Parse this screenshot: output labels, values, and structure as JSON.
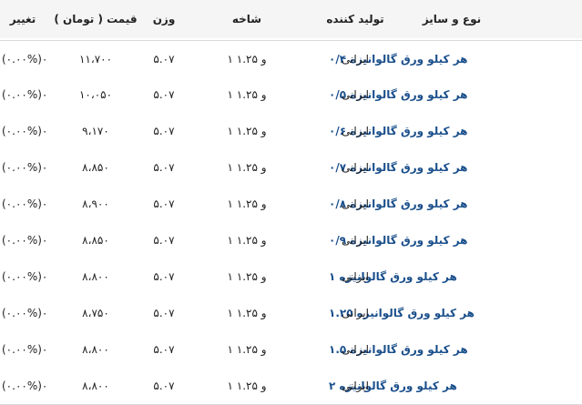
{
  "columns": {
    "name": "نوع و سایز",
    "producer": "تولید کننده",
    "branch": "شاخه",
    "weight": "وزن",
    "price": "قیمت ( تومان )",
    "change": "تغییر"
  },
  "rows": [
    {
      "name": "هر کیلو ورق گالوانیزه ۰/۴",
      "producer": "ایرانی",
      "branch": "۱ و ۱.۲۵",
      "weight": "۵.۰۷",
      "price": "۱۱،۷۰۰",
      "change": "(۰.۰۰%)۰"
    },
    {
      "name": "هر کیلو ورق گالوانیزه ۰/۵",
      "producer": "ایرانی",
      "branch": "۱ و ۱.۲۵",
      "weight": "۵.۰۷",
      "price": "۱۰،۰۵۰",
      "change": "(۰.۰۰%)۰"
    },
    {
      "name": "هر کیلو ورق گالوانیزه ۰/۶",
      "producer": "ایرانی",
      "branch": "۱ و ۱.۲۵",
      "weight": "۵.۰۷",
      "price": "۹،۱۷۰",
      "change": "(۰.۰۰%)۰"
    },
    {
      "name": "هر کیلو ورق گالوانیزه ۰/۷",
      "producer": "ایرانی",
      "branch": "۱ و ۱.۲۵",
      "weight": "۵.۰۷",
      "price": "۸،۸۵۰",
      "change": "(۰.۰۰%)۰"
    },
    {
      "name": "هر کیلو ورق گالوانیزه ۰/۸",
      "producer": "ایرانی",
      "branch": "۱ و ۱.۲۵",
      "weight": "۵.۰۷",
      "price": "۸،۹۰۰",
      "change": "(۰.۰۰%)۰"
    },
    {
      "name": "هر کیلو ورق گالوانیزه ۰/۹",
      "producer": "ایرانی",
      "branch": "۱ و ۱.۲۵",
      "weight": "۵.۰۷",
      "price": "۸،۸۵۰",
      "change": "(۰.۰۰%)۰"
    },
    {
      "name": "هر کیلو ورق گالوانیزه ۱",
      "producer": "ایرانی",
      "branch": "۱ و ۱.۲۵",
      "weight": "۵.۰۷",
      "price": "۸،۸۰۰",
      "change": "(۰.۰۰%)۰"
    },
    {
      "name": "هر کیلو ورق گالوانیزه ۱.۲۵",
      "producer": "ایرانی",
      "branch": "۱ و ۱.۲۵",
      "weight": "۵.۰۷",
      "price": "۸،۷۵۰",
      "change": "(۰.۰۰%)۰"
    },
    {
      "name": "هر کیلو ورق گالوانیزه ۱.۵",
      "producer": "ایرانی",
      "branch": "۱ و ۱.۲۵",
      "weight": "۵.۰۷",
      "price": "۸،۸۰۰",
      "change": "(۰.۰۰%)۰"
    },
    {
      "name": "هر کیلو ورق گالوانیزه ۲",
      "producer": "ایرانی",
      "branch": "۱ و ۱.۲۵",
      "weight": "۵.۰۷",
      "price": "۸،۸۰۰",
      "change": "(۰.۰۰%)۰"
    }
  ],
  "colors": {
    "link": "#1a4f8b",
    "header_bg": "#f5f5f5",
    "row_border": "#d9d9d9"
  }
}
